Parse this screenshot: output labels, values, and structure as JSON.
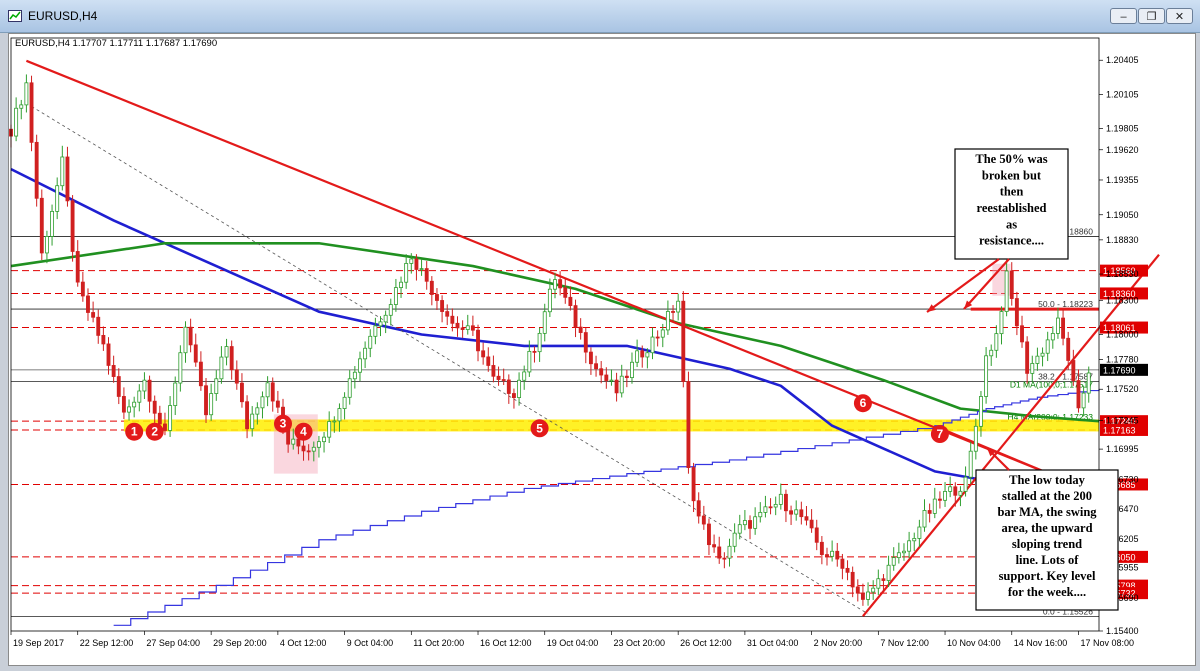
{
  "window": {
    "title": "EURUSD,H4",
    "minimize_icon": "minimize-icon",
    "restore_icon": "restore-icon",
    "close_icon": "close-icon"
  },
  "chart_header": "EURUSD,H4  1.17707 1.17711 1.17687 1.17690",
  "chart_data": {
    "type": "candlestick",
    "symbol": "EURUSD",
    "timeframe": "H4",
    "ylim": [
      1.154,
      1.206
    ],
    "y_ticks": [
      "1.20405",
      "1.20105",
      "1.19805",
      "1.19620",
      "1.19355",
      "1.19050",
      "1.18830",
      "1.18530",
      "1.18300",
      "1.18000",
      "1.17780",
      "1.17520",
      "1.17245",
      "1.16995",
      "1.16730",
      "1.16470",
      "1.16205",
      "1.15955",
      "1.15690",
      "1.15400"
    ],
    "x_ticks": [
      "19 Sep 2017",
      "22 Sep 12:00",
      "27 Sep 04:00",
      "29 Sep 20:00",
      "4 Oct 12:00",
      "9 Oct 04:00",
      "11 Oct 20:00",
      "16 Oct 12:00",
      "19 Oct 04:00",
      "23 Oct 20:00",
      "26 Oct 12:00",
      "31 Oct 04:00",
      "2 Nov 20:00",
      "7 Nov 12:00",
      "10 Nov 04:00",
      "14 Nov 16:00",
      "17 Nov 08:00"
    ],
    "price_path": [
      [
        0,
        1.198
      ],
      [
        3,
        1.202
      ],
      [
        6,
        1.187
      ],
      [
        10,
        1.195
      ],
      [
        13,
        1.184
      ],
      [
        18,
        1.179
      ],
      [
        22,
        1.173
      ],
      [
        26,
        1.176
      ],
      [
        30,
        1.171
      ],
      [
        34,
        1.181
      ],
      [
        38,
        1.173
      ],
      [
        42,
        1.179
      ],
      [
        46,
        1.172
      ],
      [
        50,
        1.176
      ],
      [
        54,
        1.1705
      ],
      [
        58,
        1.17
      ],
      [
        62,
        1.172
      ],
      [
        66,
        1.176
      ],
      [
        70,
        1.18
      ],
      [
        74,
        1.183
      ],
      [
        78,
        1.187
      ],
      [
        82,
        1.184
      ],
      [
        86,
        1.181
      ],
      [
        90,
        1.18
      ],
      [
        94,
        1.176
      ],
      [
        98,
        1.175
      ],
      [
        102,
        1.179
      ],
      [
        106,
        1.185
      ],
      [
        110,
        1.181
      ],
      [
        114,
        1.177
      ],
      [
        118,
        1.175
      ],
      [
        122,
        1.178
      ],
      [
        126,
        1.18
      ],
      [
        130,
        1.183
      ],
      [
        132,
        1.168
      ],
      [
        134,
        1.164
      ],
      [
        138,
        1.16
      ],
      [
        142,
        1.163
      ],
      [
        146,
        1.164
      ],
      [
        150,
        1.1655
      ],
      [
        154,
        1.164
      ],
      [
        158,
        1.161
      ],
      [
        162,
        1.16
      ],
      [
        166,
        1.1565
      ],
      [
        170,
        1.159
      ],
      [
        174,
        1.161
      ],
      [
        178,
        1.164
      ],
      [
        182,
        1.166
      ],
      [
        186,
        1.167
      ],
      [
        188,
        1.172
      ],
      [
        190,
        1.178
      ],
      [
        192,
        1.18
      ],
      [
        194,
        1.185
      ],
      [
        196,
        1.181
      ],
      [
        198,
        1.177
      ],
      [
        200,
        1.178
      ],
      [
        204,
        1.181
      ],
      [
        206,
        1.178
      ],
      [
        208,
        1.173
      ],
      [
        210,
        1.1769
      ]
    ],
    "n_bars": 212,
    "horizontal_levels": [
      {
        "value": 1.1856,
        "label": "1.18560",
        "color": "#e00000",
        "style": "dashed"
      },
      {
        "value": 1.1836,
        "label": "1.18360",
        "color": "#e00000",
        "style": "dashed"
      },
      {
        "value": 1.18061,
        "label": "1.18061",
        "color": "#e00000",
        "style": "dashed"
      },
      {
        "value": 1.1724,
        "label": "1.17240",
        "color": "#e00000",
        "style": "dashed"
      },
      {
        "value": 1.17163,
        "label": "1.17163",
        "color": "#e00000",
        "style": "dashed"
      },
      {
        "value": 1.16685,
        "label": "1.16685",
        "color": "#e00000",
        "style": "dashed"
      },
      {
        "value": 1.1605,
        "label": "1.16050",
        "color": "#e00000",
        "style": "dashed"
      },
      {
        "value": 1.15798,
        "label": "1.15798",
        "color": "#e00000",
        "style": "dashed"
      },
      {
        "value": 1.15732,
        "label": "1.15732",
        "color": "#e00000",
        "style": "dashed"
      },
      {
        "value": 1.1769,
        "label": "1.17690",
        "color": "#000000",
        "style": "current"
      }
    ],
    "fib_levels": [
      {
        "value": 1.1886,
        "label": "61.8 - 1.18860"
      },
      {
        "value": 1.18223,
        "label": "50.0 - 1.18223"
      },
      {
        "value": 1.17587,
        "label": "38.2 - 1.17587"
      },
      {
        "value": 1.15526,
        "label": "0.0 - 1.15526"
      }
    ],
    "ma_labels": [
      {
        "value": 1.17517,
        "label": "D1 MA(100;0;1.17517",
        "color": "#008000"
      },
      {
        "value": 1.17233,
        "label": "H4 MA(200;0; 1.17233",
        "color": "#008000"
      },
      {
        "value": 1.1668,
        "label": "1.16680",
        "color": "#008000"
      }
    ],
    "moving_averages": [
      {
        "name": "blue_ma",
        "color": "#1f1fd1",
        "points": [
          [
            0,
            1.1945
          ],
          [
            20,
            1.19
          ],
          [
            40,
            1.186
          ],
          [
            60,
            1.182
          ],
          [
            80,
            1.18
          ],
          [
            100,
            1.179
          ],
          [
            120,
            1.179
          ],
          [
            140,
            1.177
          ],
          [
            150,
            1.1755
          ],
          [
            160,
            1.172
          ],
          [
            170,
            1.17
          ],
          [
            180,
            1.168
          ],
          [
            190,
            1.1672
          ],
          [
            200,
            1.1675
          ],
          [
            212,
            1.1672
          ]
        ]
      },
      {
        "name": "green_ma",
        "color": "#209020",
        "points": [
          [
            0,
            1.186
          ],
          [
            30,
            1.188
          ],
          [
            60,
            1.188
          ],
          [
            90,
            1.186
          ],
          [
            110,
            1.184
          ],
          [
            130,
            1.181
          ],
          [
            150,
            1.179
          ],
          [
            170,
            1.176
          ],
          [
            185,
            1.1735
          ],
          [
            200,
            1.1728
          ],
          [
            212,
            1.1724
          ]
        ]
      },
      {
        "name": "step_ma",
        "color": "#3535e0",
        "points": [
          [
            20,
            1.1545
          ],
          [
            40,
            1.158
          ],
          [
            60,
            1.162
          ],
          [
            80,
            1.1645
          ],
          [
            100,
            1.1665
          ],
          [
            120,
            1.1678
          ],
          [
            140,
            1.169
          ],
          [
            160,
            1.1705
          ],
          [
            180,
            1.172
          ],
          [
            190,
            1.1735
          ],
          [
            200,
            1.1745
          ],
          [
            212,
            1.1752
          ]
        ]
      }
    ],
    "annotations": [
      {
        "text": "The 50% was broken but then reestablished as resistance....",
        "box": "top-right"
      },
      {
        "text": "The low today stalled at the 200 bar MA, the swing area, the upward sloping trend line. Lots of support. Key level for the week....",
        "box": "bottom-right"
      }
    ],
    "markers": [
      {
        "label": "1",
        "bar": 24,
        "value": 1.172
      },
      {
        "label": "2",
        "bar": 28,
        "value": 1.172
      },
      {
        "label": "3",
        "bar": 53,
        "value": 1.1727
      },
      {
        "label": "4",
        "bar": 57,
        "value": 1.172
      },
      {
        "label": "5",
        "bar": 103,
        "value": 1.1723
      },
      {
        "label": "6",
        "bar": 166,
        "value": 1.1745
      },
      {
        "label": "7",
        "bar": 181,
        "value": 1.1718
      }
    ]
  }
}
